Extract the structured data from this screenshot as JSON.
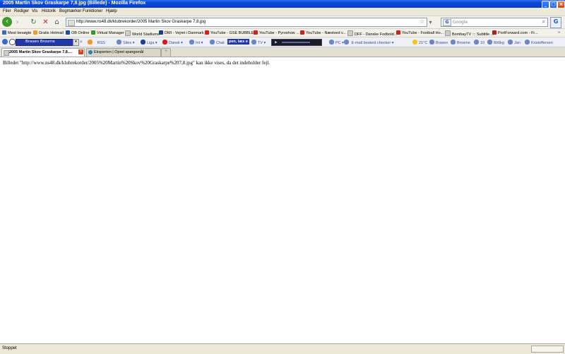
{
  "window": {
    "title": "2005 Martin Skov Graskarpe 7,8.jpg (Billede) - Mozilla Firefox"
  },
  "menu": [
    "Filer",
    "Rediger",
    "Vis",
    "Historik",
    "Bogmærker",
    "Funktioner",
    "Hjælp"
  ],
  "nav": {
    "url": "http://www.ns48.dk/klubrekorder/2005 Martin Skov Graskarpe 7,8.jpg",
    "search_placeholder": "Google"
  },
  "bookmarks": [
    "Mest besøgte",
    "Gratis Hotmail",
    "OB Online",
    "Virtual Manager",
    "World Stadiums",
    "DMI - Vejret i Danmark",
    "YouTube - GSE BUBBLES",
    "YouTube - Pyroshow ...",
    "YouTube - Næstved v...",
    "DFF - Danske Fodbold...",
    "YouTube - Football Ho...",
    "BombayTV ::: Subtitle ...",
    "PortForward.com - Fr..."
  ],
  "toolbar": {
    "select_value": "Brasen Brosme",
    "items": [
      "RSS",
      "Sites",
      "Liga",
      "Dansk",
      "Int",
      "Chat",
      "pen, læs e",
      "TV",
      "PC",
      "E-mail besked checker",
      "21°C",
      "Brasen",
      "Brosme",
      "10",
      "8ö6kg",
      "Jan",
      "Kristoffersen"
    ]
  },
  "tabs": [
    {
      "label": "2005 Martin Skov Graskarpe 7,8....",
      "active": true
    },
    {
      "label": "Eksperten | Opret spørgsmål",
      "active": false
    }
  ],
  "content": {
    "message": "Billedet \"http://www.ns48.dk/klubrekorder/2005%20Martin%20Skov%20Graskarpe%207,8.jpg\" kan ikke vises, da det indeholder fejl."
  },
  "status": {
    "text": "Stoppet"
  }
}
